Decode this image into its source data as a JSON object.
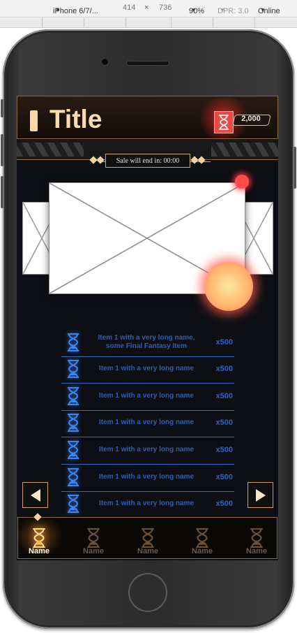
{
  "devtools": {
    "device": "iPhone 6/7/...",
    "width": "414",
    "times": "×",
    "height": "736",
    "zoom": "90%",
    "dpr": "DPR: 3.0",
    "network": "Online"
  },
  "header": {
    "title": "Title",
    "currency_value": "2,000",
    "currency_icon": "hourglass-icon"
  },
  "sale": {
    "text": "Sale will end in: 00:00"
  },
  "items": [
    {
      "name": "Item 1 with a very long name, some Final Fantasy Item",
      "qty": "x500",
      "icon": "hourglass-icon"
    },
    {
      "name": "Item 1 with a very long name",
      "qty": "x500",
      "icon": "hourglass-icon"
    },
    {
      "name": "Item 1 with a very long name",
      "qty": "x500",
      "icon": "hourglass-icon"
    },
    {
      "name": "Item 1 with a very long name",
      "qty": "x500",
      "icon": "hourglass-icon"
    },
    {
      "name": "Item 1 with a very long name",
      "qty": "x500",
      "icon": "hourglass-icon"
    },
    {
      "name": "Item 1 with a very long name",
      "qty": "x500",
      "icon": "hourglass-icon"
    },
    {
      "name": "Item 1 with a very long name",
      "qty": "x500",
      "icon": "hourglass-icon"
    }
  ],
  "tabs": [
    {
      "label": "Name",
      "active": true,
      "icon": "hourglass-icon"
    },
    {
      "label": "Name",
      "active": false,
      "icon": "hourglass-icon"
    },
    {
      "label": "Name",
      "active": false,
      "icon": "hourglass-icon"
    },
    {
      "label": "Name",
      "active": false,
      "icon": "hourglass-icon"
    },
    {
      "label": "Name",
      "active": false,
      "icon": "hourglass-icon"
    }
  ],
  "colors": {
    "gold_accent": "#fbdcb0",
    "frame_bronze": "#8a6a42",
    "item_blue": "#2b5fb0",
    "currency_red": "#e94a46",
    "screen_bg": "#0d0f14"
  }
}
